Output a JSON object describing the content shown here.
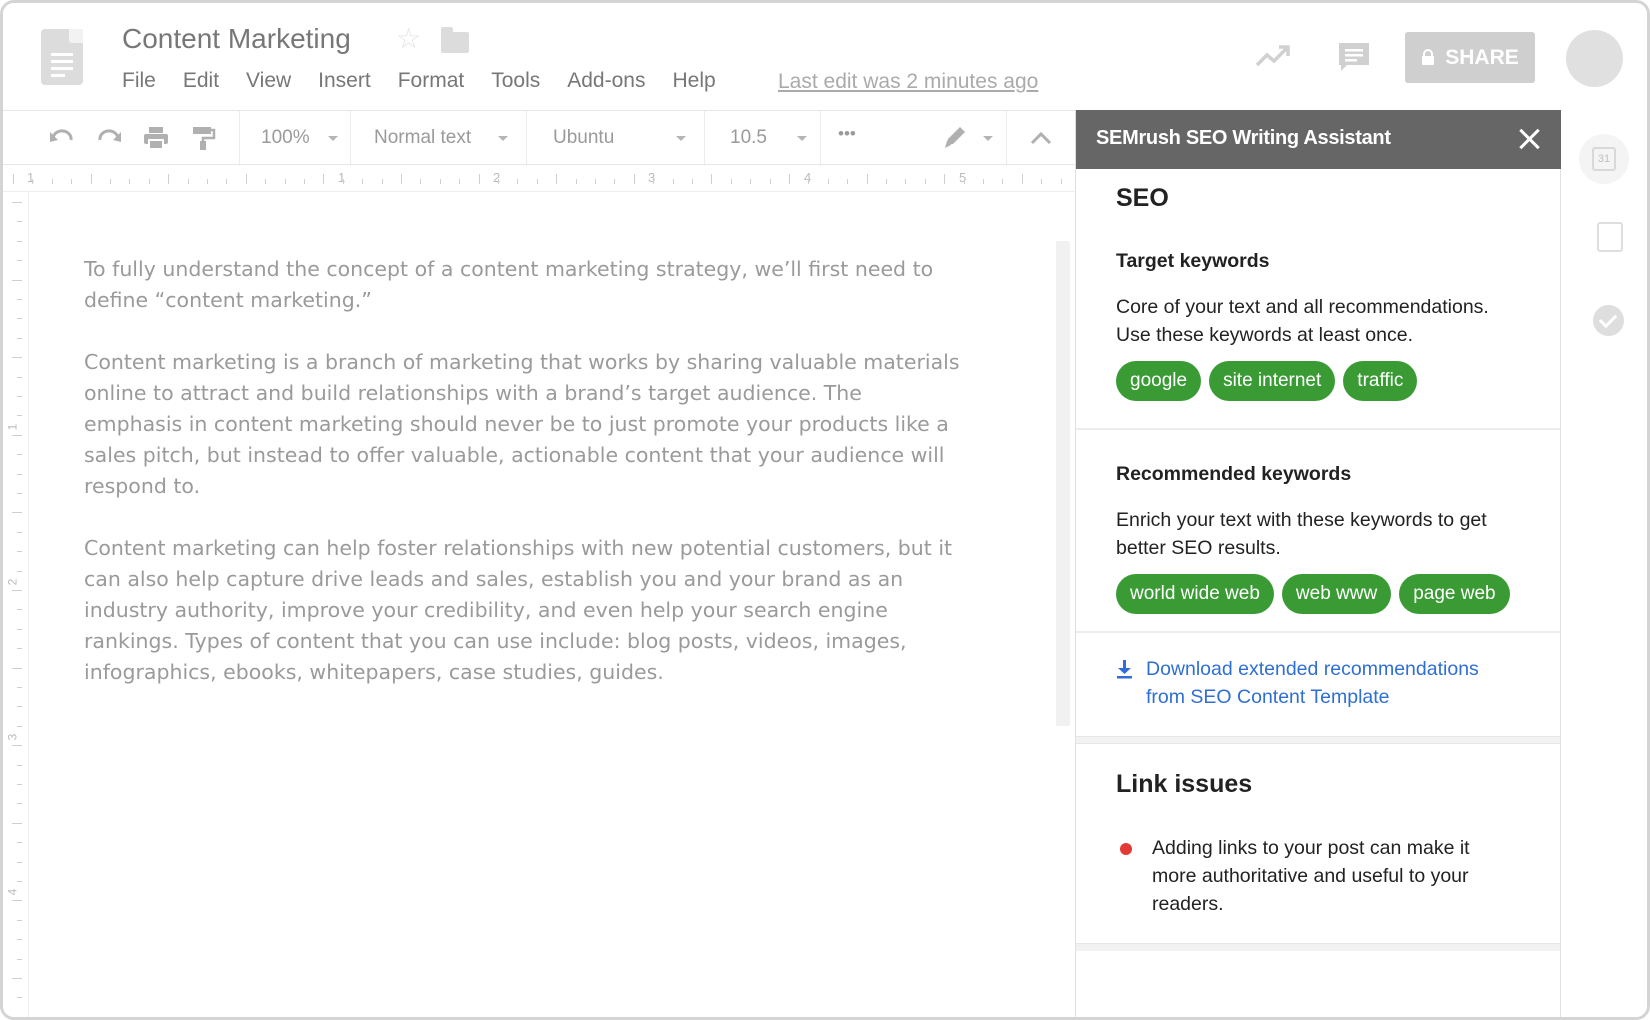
{
  "document": {
    "title": "Content Marketing",
    "last_edit": "Last edit was 2 minutes ago",
    "paragraphs": [
      "To fully understand the concept of a content marketing strategy, we’ll first need to define “content marketing.”",
      "Content marketing is a branch of marketing that works by sharing valuable materials online to attract and build relationships with a brand’s target audience. The emphasis in content marketing should never be to just promote your products like a sales pitch, but instead to offer valuable, actionable content that your audience will respond to.",
      "Content marketing can help foster relationships with new potential customers, but it can also help capture drive leads and sales, establish you and your brand as an industry authority, improve your credibility, and even help your search engine rankings. Types of content that you can use include: blog posts, videos, images, infographics, ebooks, whitepapers, case studies, guides."
    ]
  },
  "menu": [
    "File",
    "Edit",
    "View",
    "Insert",
    "Format",
    "Tools",
    "Add-ons",
    "Help"
  ],
  "header": {
    "share_label": "SHARE"
  },
  "toolbar": {
    "zoom": "100%",
    "style": "Normal text",
    "font": "Ubuntu",
    "font_size": "10.5",
    "more": "•••"
  },
  "ruler": {
    "h_numbers": [
      "1",
      "1",
      "2",
      "3",
      "4",
      "5"
    ],
    "v_numbers": [
      "1",
      "2",
      "3",
      "4"
    ]
  },
  "panel": {
    "title": "SEMrush SEO Writing Assistant",
    "seo_heading": "SEO",
    "target": {
      "title": "Target keywords",
      "desc": "Core of your text and all recommendations. Use these keywords at least once.",
      "keywords": [
        "google",
        "site internet",
        "traffic"
      ]
    },
    "recommended": {
      "title": "Recommended keywords",
      "desc": "Enrich your text with these keywords to get better SEO results.",
      "keywords": [
        "world wide web",
        "web www",
        "page web"
      ]
    },
    "download_link": "Download extended recommendations from SEO Content Template",
    "link_issues": {
      "title": "Link issues",
      "items": [
        "Adding links to your post can make it more authoritative and useful to your readers."
      ]
    }
  },
  "rail": {
    "calendar_day": "31"
  },
  "colors": {
    "keyword_chip": "#3a9b35",
    "panel_header": "#666666",
    "link": "#2f6fd3",
    "issue_bullet": "#e53935"
  },
  "icons": [
    "doc-icon",
    "star-icon",
    "folder-icon",
    "trend-icon",
    "comment-icon",
    "lock-icon",
    "undo-icon",
    "redo-icon",
    "print-icon",
    "paint-format-icon",
    "pencil-icon",
    "collapse-chevron-icon",
    "close-icon",
    "download-icon",
    "calendar-icon",
    "keep-icon",
    "tasks-icon"
  ]
}
